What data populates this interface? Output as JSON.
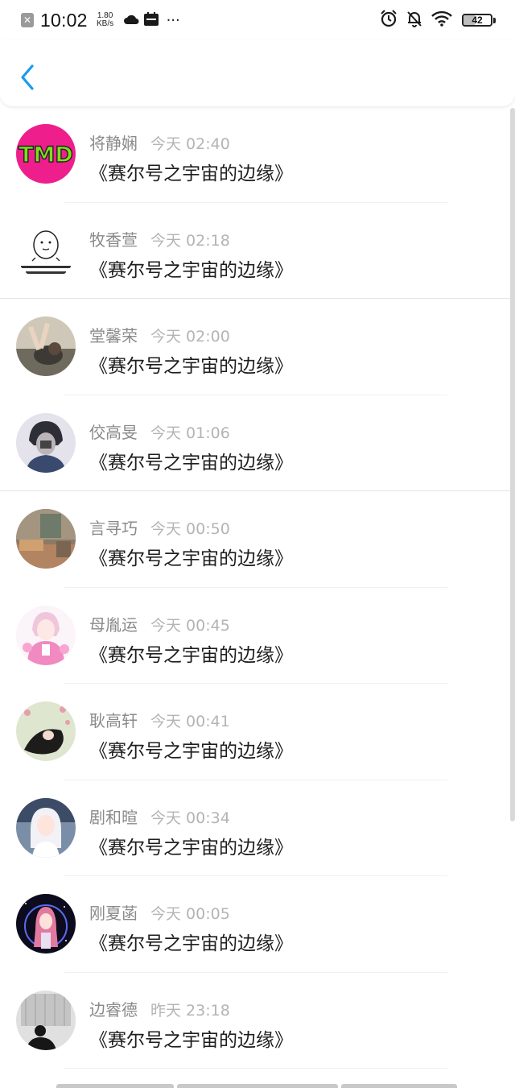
{
  "status_bar": {
    "time": "10:02",
    "net_speed_value": "1.80",
    "net_speed_unit": "KB/s",
    "more": "···",
    "battery_level": "42",
    "icons": [
      "close-notification-icon",
      "cloud-icon",
      "calendar-icon",
      "alarm-icon",
      "mute-bell-icon",
      "wifi-icon",
      "battery-icon"
    ]
  },
  "header": {
    "back_icon": "chevron-left-icon",
    "accent_color": "#1a9af0"
  },
  "list": {
    "items": [
      {
        "name": "将静娴",
        "time": "今天 02:40",
        "content": "《赛尔号之宇宙的边缘》",
        "avatar": "tmd-avatar"
      },
      {
        "name": "牧香萱",
        "time": "今天 02:18",
        "content": "《赛尔号之宇宙的边缘》",
        "avatar": "meme-avatar"
      },
      {
        "name": "堂馨荣",
        "time": "今天 02:00",
        "content": "《赛尔号之宇宙的边缘》",
        "avatar": "photo-avatar"
      },
      {
        "name": "佼高旻",
        "time": "今天 01:06",
        "content": "《赛尔号之宇宙的边缘》",
        "avatar": "anime-avatar"
      },
      {
        "name": "言寻巧",
        "time": "今天 00:50",
        "content": "《赛尔号之宇宙的边缘》",
        "avatar": "room-avatar"
      },
      {
        "name": "母胤运",
        "time": "今天 00:45",
        "content": "《赛尔号之宇宙的边缘》",
        "avatar": "pink-anime-avatar"
      },
      {
        "name": "耿高轩",
        "time": "今天 00:41",
        "content": "《赛尔号之宇宙的边缘》",
        "avatar": "flower-avatar"
      },
      {
        "name": "剧和暄",
        "time": "今天 00:34",
        "content": "《赛尔号之宇宙的边缘》",
        "avatar": "anime-girl-avatar"
      },
      {
        "name": "刚夏菡",
        "time": "今天 00:05",
        "content": "《赛尔号之宇宙的边缘》",
        "avatar": "space-anime-avatar"
      },
      {
        "name": "边睿德",
        "time": "昨天 23:18",
        "content": "《赛尔号之宇宙的边缘》",
        "avatar": "bw-photo-avatar"
      }
    ]
  }
}
